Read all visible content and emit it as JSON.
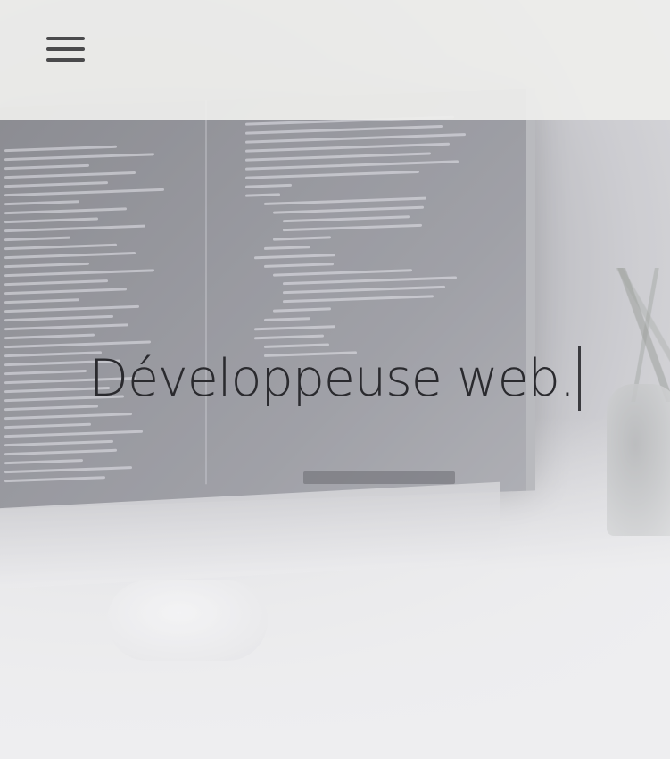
{
  "nav": {
    "menu_icon": "hamburger-menu-icon"
  },
  "hero": {
    "headline": "Développeuse web.",
    "background_image": "laptop-code-editor-photo",
    "caret_icon": "text-cursor-icon"
  },
  "colors": {
    "navbar_bg": "#eeeeec",
    "text": "#2a2a2e",
    "menu_icon": "#4a4a4c"
  }
}
